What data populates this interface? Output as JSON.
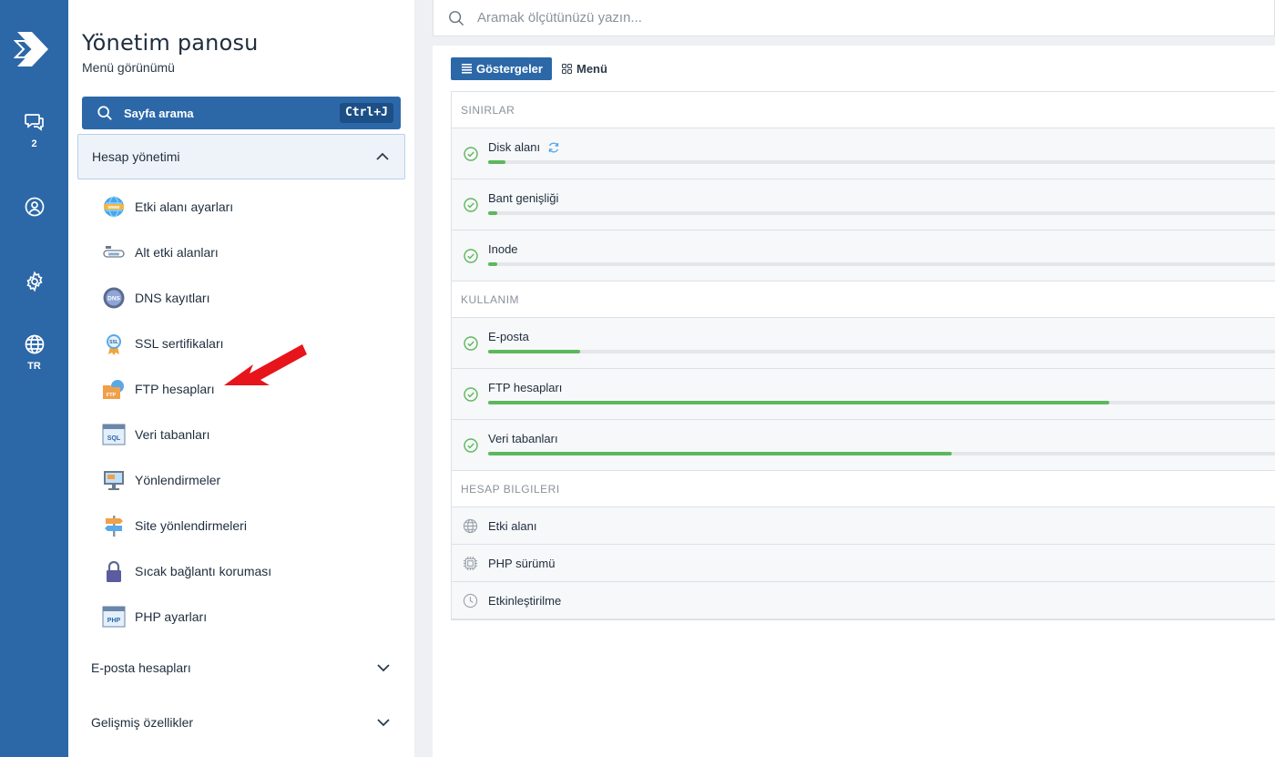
{
  "rail": {
    "notifications_count": "2",
    "language": "TR"
  },
  "sidebar": {
    "title": "Yönetim panosu",
    "subtitle": "Menü görünümü",
    "search_label": "Sayfa arama",
    "search_shortcut": "Ctrl+J",
    "open_section": "Hesap yönetimi",
    "items": [
      {
        "label": "Etki alanı ayarları",
        "icon": "www-globe-icon"
      },
      {
        "label": "Alt etki alanları",
        "icon": "subdomain-icon"
      },
      {
        "label": "DNS kayıtları",
        "icon": "dns-icon"
      },
      {
        "label": "SSL sertifikaları",
        "icon": "ssl-badge-icon"
      },
      {
        "label": "FTP hesapları",
        "icon": "ftp-folder-icon"
      },
      {
        "label": "Veri tabanları",
        "icon": "sql-database-icon"
      },
      {
        "label": "Yönlendirmeler",
        "icon": "redirect-monitor-icon"
      },
      {
        "label": "Site yönlendirmeleri",
        "icon": "signpost-icon"
      },
      {
        "label": "Sıcak bağlantı koruması",
        "icon": "padlock-icon"
      },
      {
        "label": "PHP ayarları",
        "icon": "php-window-icon"
      }
    ],
    "closed_sections": [
      "E-posta hesapları",
      "Gelişmiş özellikler"
    ]
  },
  "search": {
    "placeholder": "Aramak ölçütünüzü yazın..."
  },
  "tabs": {
    "active": "Göstergeler",
    "other": "Menü"
  },
  "stats": {
    "limits_header": "SINIRLAR",
    "limits": [
      {
        "label": "Disk alanı",
        "fraction": 0.022,
        "refresh": true
      },
      {
        "label": "Bant genişliği",
        "fraction": 0.011,
        "refresh": false
      },
      {
        "label": "Inode",
        "fraction": 0.011,
        "refresh": false
      }
    ],
    "usage_header": "KULLANIM",
    "usage": [
      {
        "label": "E-posta",
        "fraction": 0.115
      },
      {
        "label": "FTP hesapları",
        "fraction": 0.775
      },
      {
        "label": "Veri tabanları",
        "fraction": 0.578
      }
    ],
    "info_header": "HESAP BILGILERI",
    "info": [
      {
        "label": "Etki alanı",
        "icon": "globe-icon"
      },
      {
        "label": "PHP sürümü",
        "icon": "chip-icon"
      },
      {
        "label": "Etkinleştirilme",
        "icon": "clock-icon"
      }
    ]
  },
  "colors": {
    "brand_blue": "#2c68a8",
    "progress_green": "#5cb85c",
    "annotation_red": "#e8141b"
  }
}
